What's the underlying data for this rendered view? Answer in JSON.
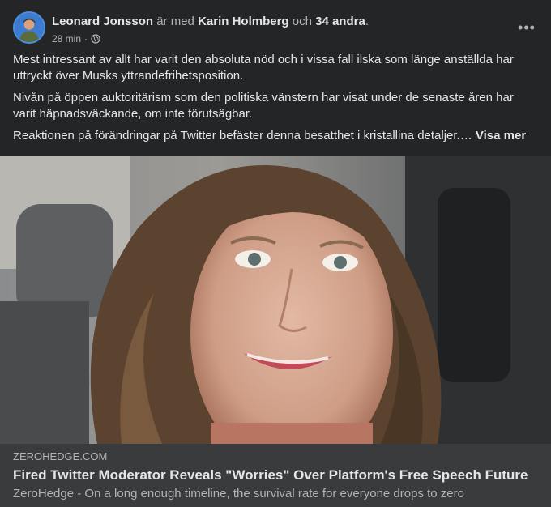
{
  "post": {
    "author": "Leonard Jonsson",
    "with_text": "är med",
    "tagged": "Karin Holmberg",
    "and_text": "och",
    "others": "34 andra",
    "period": ".",
    "time": "28 min",
    "dot": "·",
    "privacy_icon": "globe-icon",
    "more_icon": "more-options-icon",
    "more_label": "•••",
    "paragraphs": [
      "Mest intressant av allt har varit den absoluta nöd och i vissa fall ilska som länge anställda har uttryckt över Musks yttrandefrihetsposition.",
      "Nivån på öppen auktoritärism som den politiska vänstern har visat under de senaste åren har varit häpnadsväckande, om inte förutsägbar.",
      "Reaktionen på förändringar på Twitter befäster denna besatthet i kristallina detaljer.…"
    ],
    "see_more": "Visa mer"
  },
  "link_preview": {
    "domain": "ZEROHEDGE.COM",
    "title": "Fired Twitter Moderator Reveals \"Worries\" Over Platform's Free Speech Future",
    "description": "ZeroHedge - On a long enough timeline, the survival rate for everyone drops to zero"
  },
  "colors": {
    "card_bg": "#242526",
    "link_bg": "#3a3b3c",
    "text_primary": "#e4e6eb",
    "text_secondary": "#b0b3b8"
  }
}
